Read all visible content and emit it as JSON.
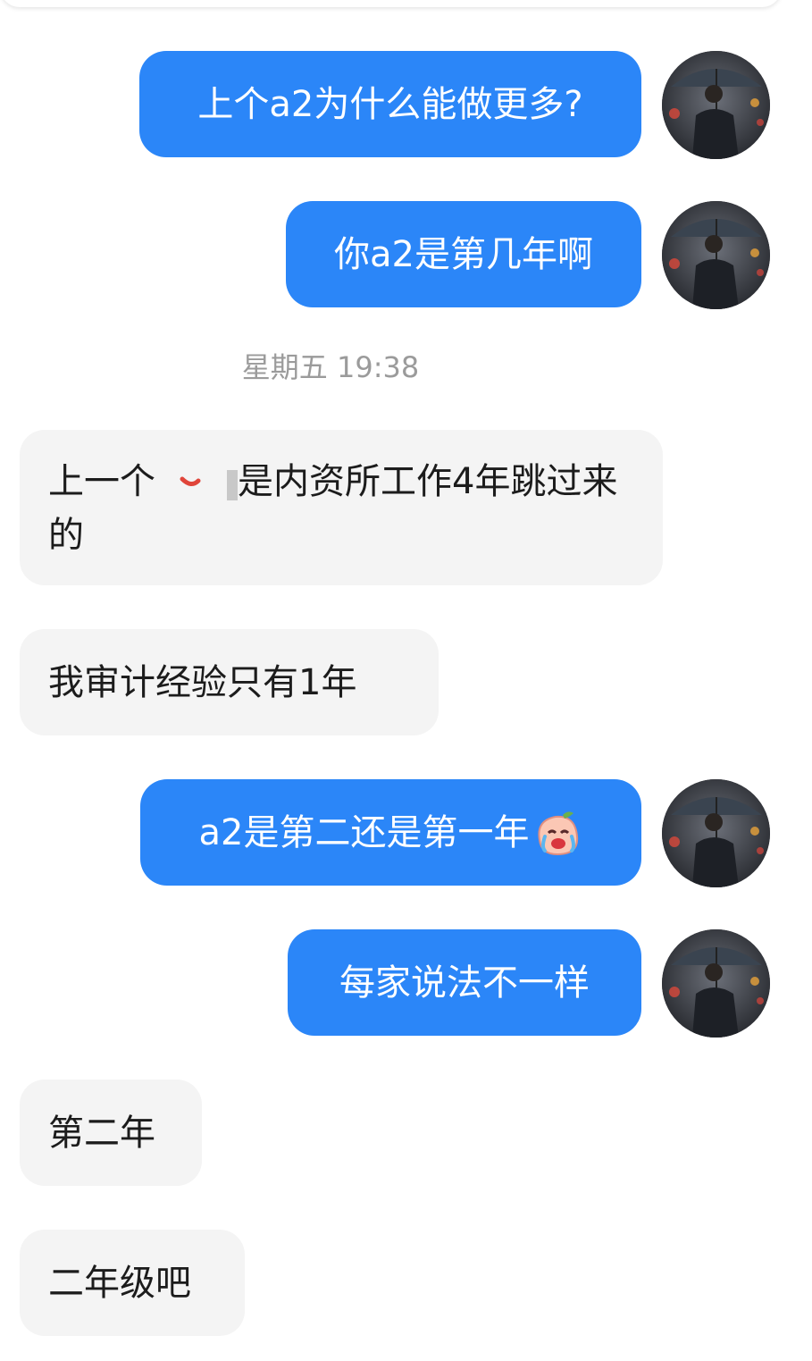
{
  "messages": [
    {
      "side": "out",
      "text": "上个a2为什么能做更多?"
    },
    {
      "side": "out",
      "text": "你a2是第几年啊"
    },
    {
      "side": "in",
      "text_before": "上一个",
      "text_after": "是内资所工作4年跳过来的"
    },
    {
      "side": "in",
      "text": "我审计经验只有1年"
    },
    {
      "side": "out",
      "text": "a2是第二还是第一年",
      "emoji": "laughing-crying-peach-emoji"
    },
    {
      "side": "out",
      "text": "每家说法不一样"
    },
    {
      "side": "in",
      "text": "第二年"
    },
    {
      "side": "in",
      "text": "二年级吧"
    }
  ],
  "timestamp": "星期五 19:38",
  "colors": {
    "outgoing_bubble": "#2b86f8",
    "incoming_bubble": "#f4f4f4",
    "timestamp_text": "#9b9b9b"
  },
  "avatar": {
    "icon": "user-avatar-umbrella-photo"
  }
}
